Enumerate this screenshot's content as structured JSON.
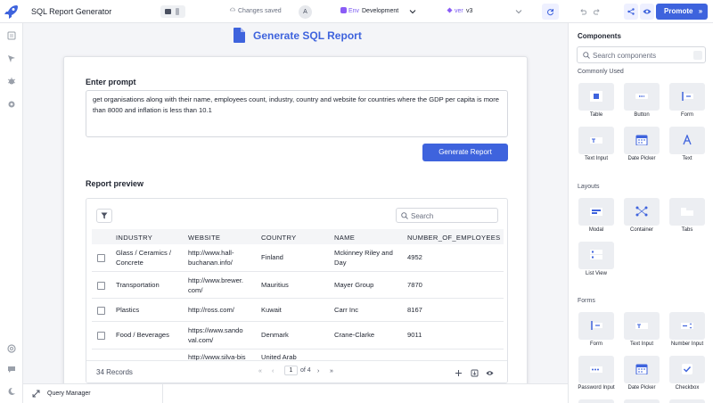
{
  "header": {
    "app_title": "SQL Report Generator",
    "save_status": "Changes saved",
    "avatar_initial": "A",
    "env_label": "Env",
    "env_value": "Development",
    "version_label": "ver",
    "version_value": "v3",
    "promote_label": "Promote"
  },
  "page": {
    "title": "Generate SQL Report",
    "prompt_label": "Enter prompt",
    "prompt_text": "get organisations along with their name, employees count, industry, country and website for countries where the GDP per capita is more than 8000 and inflation is less than 10.1",
    "generate_label": "Generate Report",
    "preview_label": "Report preview"
  },
  "table": {
    "search_placeholder": "Search",
    "columns": [
      "INDUSTRY",
      "WEBSITE",
      "COUNTRY",
      "NAME",
      "NUMBER_OF_EMPLOYEES"
    ],
    "rows": [
      {
        "industry": [
          "Glass / Ceramics /",
          "Concrete"
        ],
        "website": [
          "http://www.hall-",
          "buchanan.info/"
        ],
        "country": "Finland",
        "name": [
          "Mckinney Riley and",
          "Day"
        ],
        "employees": "4952"
      },
      {
        "industry": [
          "Transportation",
          ""
        ],
        "website": [
          "http://www.brewer.",
          "com/"
        ],
        "country": "Mauritius",
        "name": [
          "Mayer Group",
          ""
        ],
        "employees": "7870"
      },
      {
        "industry": [
          "Plastics",
          ""
        ],
        "website": [
          "http://ross.com/",
          ""
        ],
        "country": "Kuwait",
        "name": [
          "Carr Inc",
          ""
        ],
        "employees": "8167"
      },
      {
        "industry": [
          "Food / Beverages",
          ""
        ],
        "website": [
          "https://www.sando",
          "val.com/"
        ],
        "country": "Denmark",
        "name": [
          "Crane-Clarke",
          ""
        ],
        "employees": "9011"
      },
      {
        "industry": [
          "",
          ""
        ],
        "website": [
          "http://www.silva-bis",
          ""
        ],
        "country": "United Arab",
        "name": [
          "",
          ""
        ],
        "employees": ""
      }
    ],
    "records_label": "34 Records",
    "current_page": "1",
    "page_total": "of 4"
  },
  "bottom": {
    "query_manager_label": "Query Manager"
  },
  "components_panel": {
    "title": "Components",
    "search_placeholder": "Search components",
    "sections": {
      "common": "Commonly Used",
      "layouts": "Layouts",
      "forms": "Forms"
    },
    "common_items": [
      "Table",
      "Button",
      "Form",
      "Text Input",
      "Date Picker",
      "Text"
    ],
    "layout_items": [
      "Modal",
      "Container",
      "Tabs",
      "List View"
    ],
    "form_items": [
      "Form",
      "Text Input",
      "Number Input",
      "Password Input",
      "Date Picker",
      "Checkbox"
    ]
  },
  "colors": {
    "accent": "#3e63dd",
    "env": "#8a5cf6"
  }
}
